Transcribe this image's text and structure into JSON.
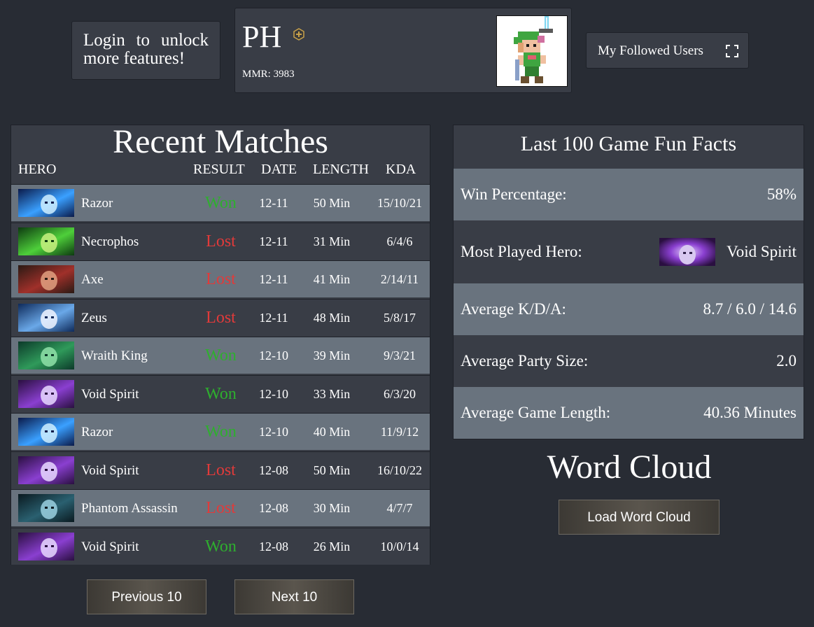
{
  "login": {
    "text": "Login to unlock more features!"
  },
  "profile": {
    "name": "PH",
    "mmr": "MMR: 3983"
  },
  "followed": {
    "label": "My Followed Users"
  },
  "matches": {
    "title": "Recent Matches",
    "headers": {
      "hero": "HERO",
      "result": "RESULT",
      "date": "DATE",
      "length": "LENGTH",
      "kda": "KDA"
    },
    "rows": [
      {
        "hero": "Razor",
        "result": "Won",
        "date": "12-11",
        "length": "50 Min",
        "kda": "15/10/21"
      },
      {
        "hero": "Necrophos",
        "result": "Lost",
        "date": "12-11",
        "length": "31 Min",
        "kda": "6/4/6"
      },
      {
        "hero": "Axe",
        "result": "Lost",
        "date": "12-11",
        "length": "41 Min",
        "kda": "2/14/11"
      },
      {
        "hero": "Zeus",
        "result": "Lost",
        "date": "12-11",
        "length": "48 Min",
        "kda": "5/8/17"
      },
      {
        "hero": "Wraith King",
        "result": "Won",
        "date": "12-10",
        "length": "39 Min",
        "kda": "9/3/21"
      },
      {
        "hero": "Void Spirit",
        "result": "Won",
        "date": "12-10",
        "length": "33 Min",
        "kda": "6/3/20"
      },
      {
        "hero": "Razor",
        "result": "Won",
        "date": "12-10",
        "length": "40 Min",
        "kda": "11/9/12"
      },
      {
        "hero": "Void Spirit",
        "result": "Lost",
        "date": "12-08",
        "length": "50 Min",
        "kda": "16/10/22"
      },
      {
        "hero": "Phantom Assassin",
        "result": "Lost",
        "date": "12-08",
        "length": "30 Min",
        "kda": "4/7/7"
      },
      {
        "hero": "Void Spirit",
        "result": "Won",
        "date": "12-08",
        "length": "26 Min",
        "kda": "10/0/14"
      }
    ]
  },
  "pagination": {
    "prev": "Previous 10",
    "next": "Next 10"
  },
  "facts": {
    "title": "Last 100 Game Fun Facts",
    "win_label": "Win Percentage:",
    "win_value": "58%",
    "hero_label": "Most Played Hero:",
    "hero_value": "Void Spirit",
    "kda_label": "Average K/D/A:",
    "kda_value": "8.7 / 6.0 / 14.6",
    "party_label": "Average Party Size:",
    "party_value": "2.0",
    "length_label": "Average Game Length:",
    "length_value": "40.36 Minutes"
  },
  "word_cloud": {
    "title": "Word Cloud",
    "button": "Load Word Cloud"
  },
  "colors": {
    "won": "#2eaf2e",
    "lost": "#e13a3a",
    "row_light": "#69737e",
    "row_dark": "#393d46",
    "background": "#282c34"
  }
}
